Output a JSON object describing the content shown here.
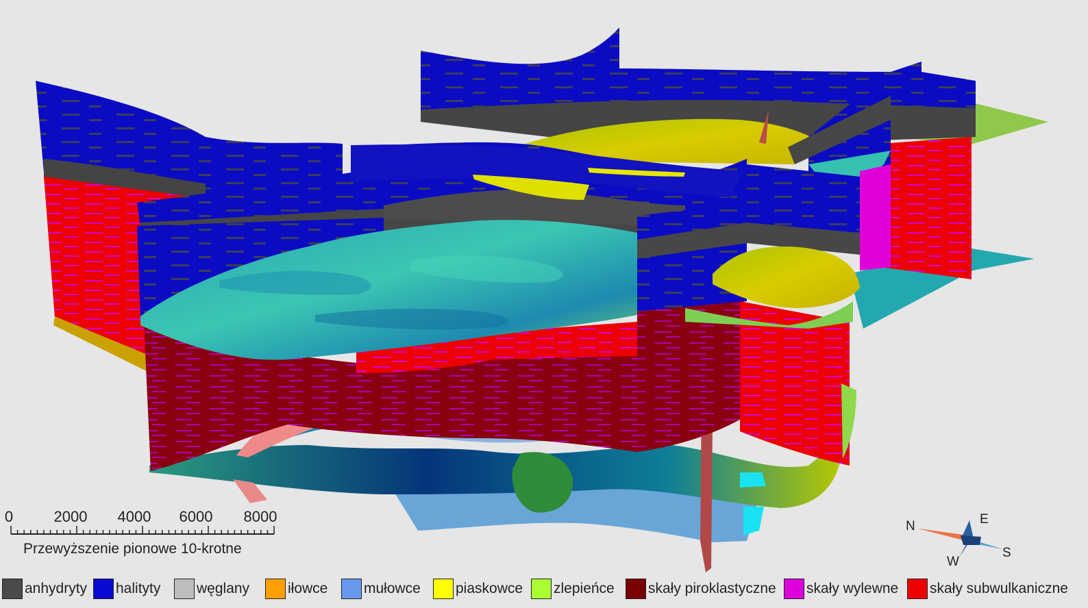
{
  "scale_bar": {
    "ticks": [
      "0",
      "2000",
      "4000",
      "6000",
      "8000"
    ],
    "caption": "Przewyższenie pionowe 10-krotne"
  },
  "compass": {
    "n": "N",
    "e": "E",
    "s": "S",
    "w": "W"
  },
  "legend": [
    {
      "label": "anhydryty",
      "color": "#4a4a4a"
    },
    {
      "label": "halityty",
      "color": "#0a0ad2"
    },
    {
      "label": "węglany",
      "color": "#bdbdbd"
    },
    {
      "label": "iłowce",
      "color": "#ffa000"
    },
    {
      "label": "mułowce",
      "color": "#6699ee"
    },
    {
      "label": "piaskowce",
      "color": "#ffff00"
    },
    {
      "label": "zlepieńce",
      "color": "#aaff33"
    },
    {
      "label": "skały piroklastyczne",
      "color": "#7a0000"
    },
    {
      "label": "skały wylewne",
      "color": "#dd00dd"
    },
    {
      "label": "skały subwulkaniczne",
      "color": "#ee0000"
    }
  ],
  "colors": {
    "background": "#e6e6e6",
    "surface_teal": "#2fb7b0",
    "surface_green": "#8fd84a",
    "surface_yellow": "#d7d000",
    "siltstone_blue": "#6aa5d8"
  }
}
